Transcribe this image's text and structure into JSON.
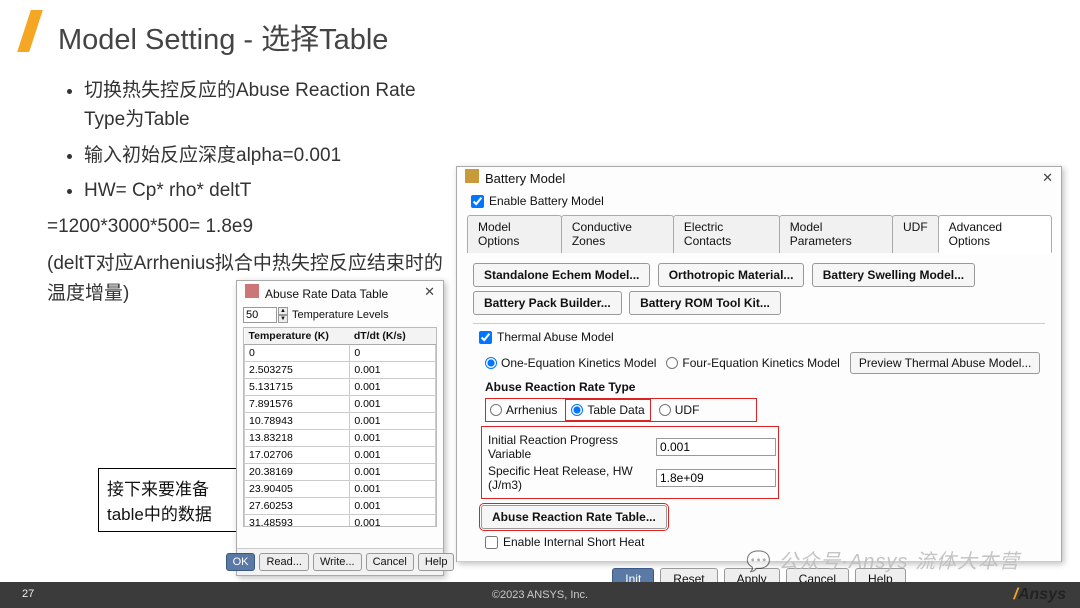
{
  "slide": {
    "title": "Model Setting - 选择Table",
    "bullets": [
      "切换热失控反应的Abuse Reaction Rate Type为Table",
      "输入初始反应深度alpha=0.001",
      "HW= Cp* rho* deltT"
    ],
    "eq": "=1200*3000*500= 1.8e9",
    "paren": "(deltT对应Arrhenius拟合中热失控反应结束时的温度增量)",
    "note": "接下来要准备table中的数据",
    "page": "27",
    "copyright": "©2023 ANSYS, Inc.",
    "logo": "Ansys"
  },
  "abuse_dialog": {
    "title": "Abuse Rate Data Table",
    "temp_levels_value": "50",
    "temp_levels_label": "Temperature Levels",
    "col_temp": "Temperature (K)",
    "col_rate": "dT/dt (K/s)",
    "rows": [
      {
        "t": "0",
        "r": "0"
      },
      {
        "t": "2.503275",
        "r": "0.001"
      },
      {
        "t": "5.131715",
        "r": "0.001"
      },
      {
        "t": "7.891576",
        "r": "0.001"
      },
      {
        "t": "10.78943",
        "r": "0.001"
      },
      {
        "t": "13.83218",
        "r": "0.001"
      },
      {
        "t": "17.02706",
        "r": "0.001"
      },
      {
        "t": "20.38169",
        "r": "0.001"
      },
      {
        "t": "23.90405",
        "r": "0.001"
      },
      {
        "t": "27.60253",
        "r": "0.001"
      },
      {
        "t": "31.48593",
        "r": "0.001"
      }
    ],
    "buttons": {
      "ok": "OK",
      "read": "Read...",
      "write": "Write...",
      "cancel": "Cancel",
      "help": "Help"
    }
  },
  "battery_dialog": {
    "title": "Battery Model",
    "enable": "Enable Battery Model",
    "tabs": [
      "Model Options",
      "Conductive Zones",
      "Electric Contacts",
      "Model Parameters",
      "UDF",
      "Advanced Options"
    ],
    "active_tab": 5,
    "model_btns": {
      "echem": "Standalone Echem Model...",
      "ortho": "Orthotropic Material...",
      "swell": "Battery Swelling Model...",
      "pack": "Battery Pack Builder...",
      "rom": "Battery ROM Tool Kit..."
    },
    "thermal_abuse": "Thermal Abuse Model",
    "kinetics": {
      "one": "One-Equation Kinetics Model",
      "four": "Four-Equation Kinetics Model",
      "preview": "Preview Thermal Abuse Model..."
    },
    "rate_type": {
      "label": "Abuse Reaction Rate Type",
      "arr": "Arrhenius",
      "table": "Table Data",
      "udf": "UDF"
    },
    "init_progress_label": "Initial Reaction Progress Variable",
    "init_progress_value": "0.001",
    "hw_label": "Specific Heat Release, HW (J/m3)",
    "hw_value": "1.8e+09",
    "table_btn": "Abuse Reaction Rate Table...",
    "short_heat": "Enable Internal Short Heat",
    "footer": {
      "init": "Init",
      "reset": "Reset",
      "apply": "Apply",
      "cancel": "Cancel",
      "help": "Help"
    }
  },
  "watermark": "公众号·Ansys 流体大本营"
}
